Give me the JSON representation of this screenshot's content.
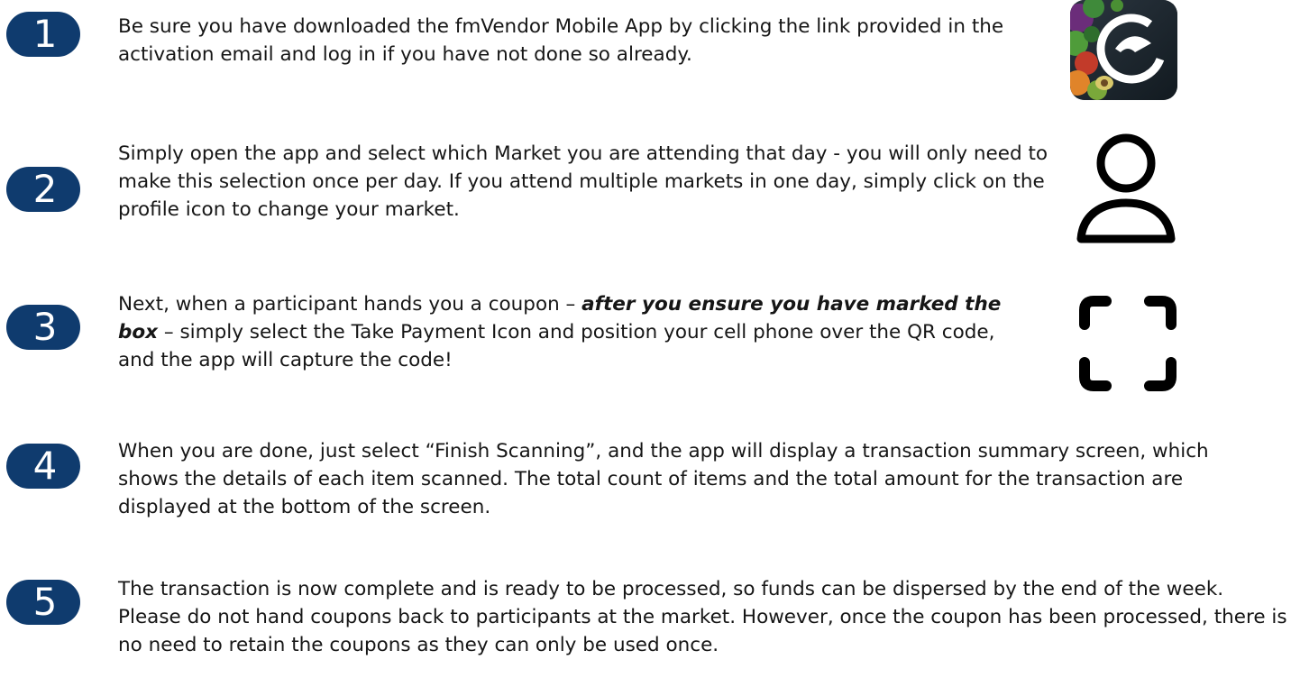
{
  "steps": [
    {
      "number": "1",
      "text": "Be sure you have downloaded the fmVendor Mobile App by clicking the link provided in the activation email and log in if you have not done so already."
    },
    {
      "number": "2",
      "text": "Simply open the app and select which Market you are attending that day - you will only need to make this selection once per day. If you attend multiple markets in one day, simply click on the profile icon to change your market."
    },
    {
      "number": "3",
      "text_before": "Next, when a participant hands you a coupon – ",
      "text_emphasis": "after you ensure you have marked the box",
      "text_after": " – simply select the Take Payment Icon and position your cell phone over the QR code, and the app will capture the code!"
    },
    {
      "number": "4",
      "text": "When you are done, just select “Finish Scanning”, and the app will display a transaction summary screen, which shows the details of each item scanned. The total count of items and the total amount for the transaction are displayed at the bottom of the screen."
    },
    {
      "number": "5",
      "text": "The transaction is now complete and is ready to be processed, so funds can be dispersed by the end of the week. Please do not hand coupons back to participants at the market. However, once the coupon has been processed, there is no need to retain the coupons as they can only be used once."
    }
  ],
  "icons": {
    "app": "fmvendor-app-icon",
    "profile": "profile-icon",
    "take_payment": "take-payment-scan-icon"
  },
  "colors": {
    "badge": "#0f3b6e",
    "text": "#161616",
    "icon_stroke": "#000000"
  }
}
